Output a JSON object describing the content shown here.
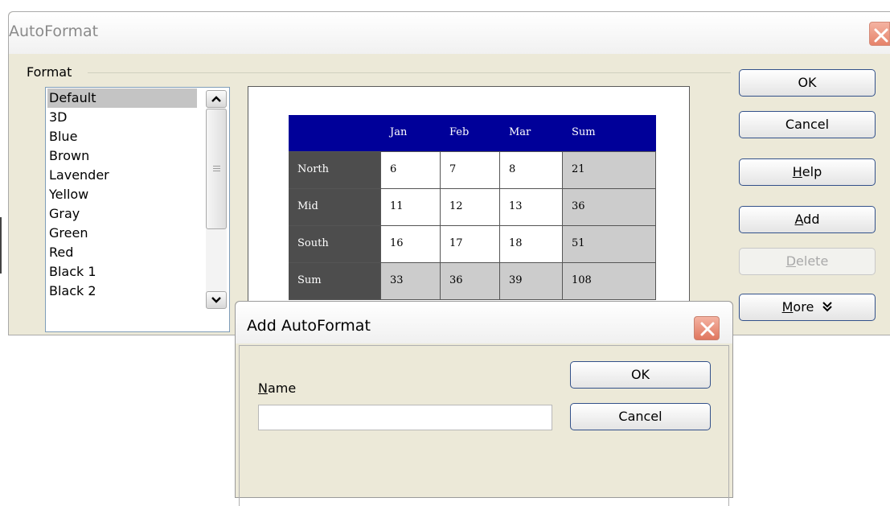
{
  "dialog": {
    "title": "AutoFormat",
    "group_label": "Format",
    "formats": [
      "Default",
      "3D",
      "Blue",
      "Brown",
      "Lavender",
      "Yellow",
      "Gray",
      "Green",
      "Red",
      "Black 1",
      "Black 2"
    ],
    "selected_format": "Default"
  },
  "preview": {
    "header": [
      "",
      "Jan",
      "Feb",
      "Mar",
      "Sum"
    ],
    "rows": [
      [
        "North",
        "6",
        "7",
        "8",
        "21"
      ],
      [
        "Mid",
        "11",
        "12",
        "13",
        "36"
      ],
      [
        "South",
        "16",
        "17",
        "18",
        "51"
      ],
      [
        "Sum",
        "33",
        "36",
        "39",
        "108"
      ]
    ],
    "colors": {
      "header": "#000099",
      "row_header": "#4d4d4d",
      "cell": "#ffffff",
      "sum": "#cccccc"
    }
  },
  "buttons": {
    "ok": "OK",
    "cancel": "Cancel",
    "help": {
      "mnemonic": "H",
      "rest": "elp"
    },
    "add": {
      "mnemonic": "A",
      "rest": "dd"
    },
    "delete": {
      "mnemonic": "D",
      "rest": "elete"
    },
    "more": {
      "mnemonic": "M",
      "rest": "ore"
    },
    "more_icon": "double-chevron-down-icon"
  },
  "add_dialog": {
    "title": "Add AutoFormat",
    "name_label": {
      "mnemonic": "N",
      "rest": "ame"
    },
    "name_value": "",
    "ok": "OK",
    "cancel": "Cancel"
  }
}
